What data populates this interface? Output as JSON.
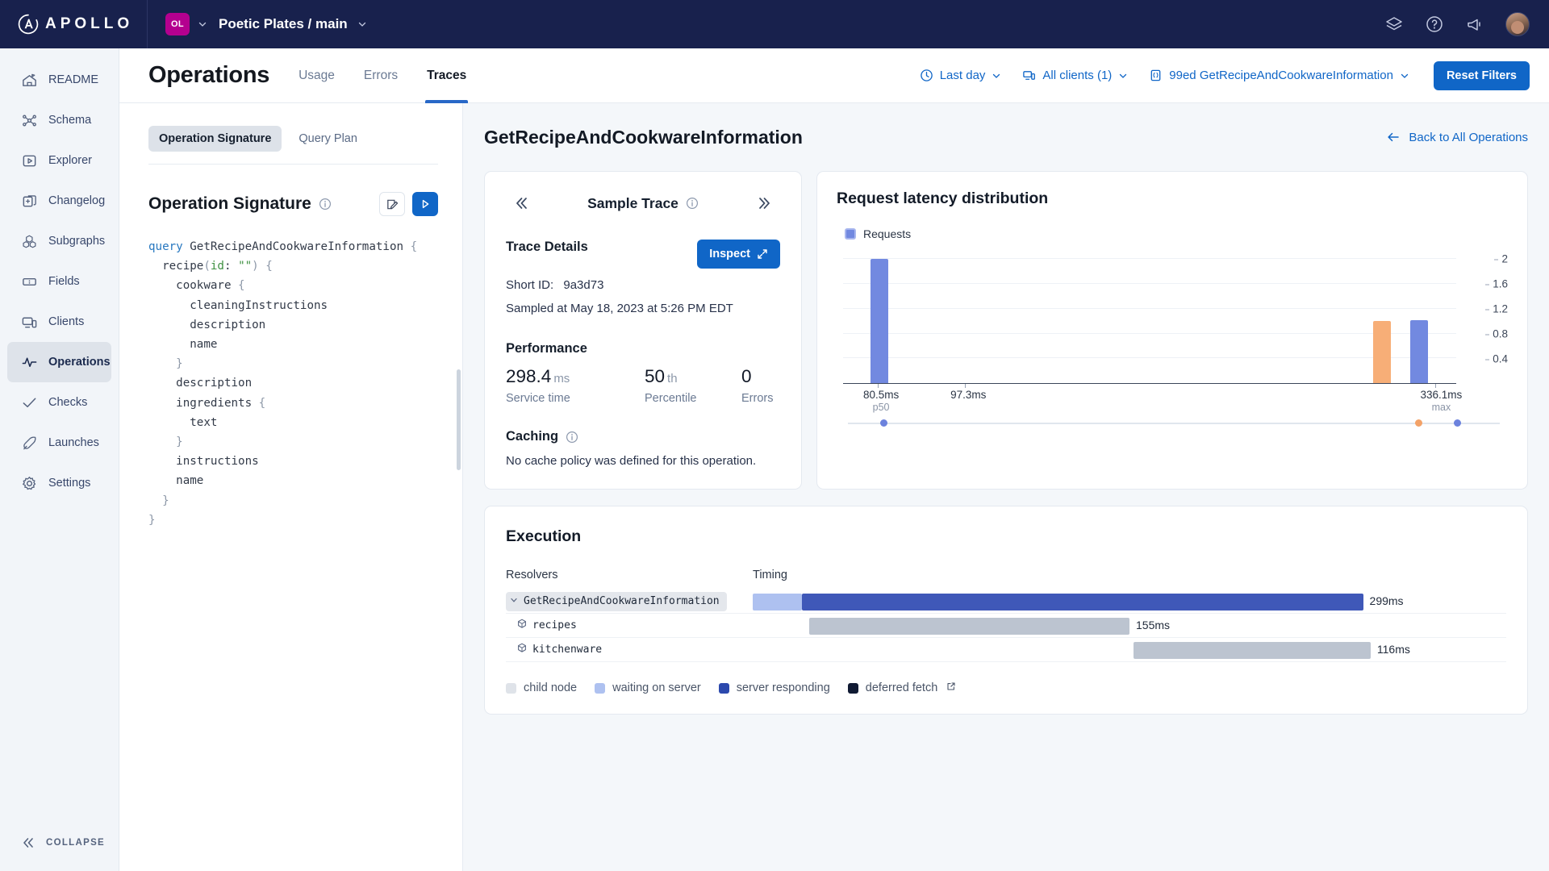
{
  "topbar": {
    "logo_text": "APOLLO",
    "org_badge": "OL",
    "graph_title": "Poetic Plates / main",
    "icons": [
      "graph-icon",
      "help-icon",
      "announcements-icon",
      "user-avatar"
    ]
  },
  "sidebar": {
    "items": [
      {
        "label": "README",
        "icon": "readme-icon",
        "active": false
      },
      {
        "label": "Schema",
        "icon": "schema-icon",
        "active": false
      },
      {
        "label": "Explorer",
        "icon": "explorer-icon",
        "active": false
      },
      {
        "label": "Changelog",
        "icon": "changelog-icon",
        "active": false
      },
      {
        "label": "Subgraphs",
        "icon": "subgraphs-icon",
        "active": false
      },
      {
        "label": "Fields",
        "icon": "fields-icon",
        "active": false
      },
      {
        "label": "Clients",
        "icon": "clients-icon",
        "active": false
      },
      {
        "label": "Operations",
        "icon": "operations-icon",
        "active": true
      },
      {
        "label": "Checks",
        "icon": "checks-icon",
        "active": false
      },
      {
        "label": "Launches",
        "icon": "launches-icon",
        "active": false
      },
      {
        "label": "Settings",
        "icon": "settings-icon",
        "active": false
      }
    ],
    "collapse_label": "COLLAPSE"
  },
  "operations_header": {
    "title": "Operations",
    "tabs": [
      {
        "label": "Usage",
        "active": false
      },
      {
        "label": "Errors",
        "active": false
      },
      {
        "label": "Traces",
        "active": true
      }
    ],
    "filters": [
      {
        "label": "Last day",
        "icon": "clock-icon"
      },
      {
        "label": "All clients (1)",
        "icon": "clients-icon"
      },
      {
        "label": "99ed GetRecipeAndCookwareInformation",
        "icon": "braces-icon"
      }
    ],
    "reset_label": "Reset Filters"
  },
  "signature_panel": {
    "tabs": [
      {
        "label": "Operation Signature",
        "active": true
      },
      {
        "label": "Query Plan",
        "active": false
      }
    ],
    "heading": "Operation Signature",
    "code_lines": [
      {
        "parts": [
          {
            "t": "query ",
            "c": "k-query"
          },
          {
            "t": "GetRecipeAndCookwareInformation ",
            "c": ""
          },
          {
            "t": "{",
            "c": "k-punc"
          }
        ]
      },
      {
        "parts": [
          {
            "t": "  recipe",
            "c": ""
          },
          {
            "t": "(",
            "c": "k-punc"
          },
          {
            "t": "id",
            "c": "k-arg"
          },
          {
            "t": ": ",
            "c": ""
          },
          {
            "t": "\"\"",
            "c": "k-arg"
          },
          {
            "t": ")",
            "c": "k-punc"
          },
          {
            "t": " ",
            "c": ""
          },
          {
            "t": "{",
            "c": "k-punc"
          }
        ]
      },
      {
        "parts": [
          {
            "t": "    cookware ",
            "c": ""
          },
          {
            "t": "{",
            "c": "k-punc"
          }
        ]
      },
      {
        "parts": [
          {
            "t": "      cleaningInstructions",
            "c": ""
          }
        ]
      },
      {
        "parts": [
          {
            "t": "      description",
            "c": ""
          }
        ]
      },
      {
        "parts": [
          {
            "t": "      name",
            "c": ""
          }
        ]
      },
      {
        "parts": [
          {
            "t": "    ",
            "c": ""
          },
          {
            "t": "}",
            "c": "k-punc"
          }
        ]
      },
      {
        "parts": [
          {
            "t": "    description",
            "c": ""
          }
        ]
      },
      {
        "parts": [
          {
            "t": "    ingredients ",
            "c": ""
          },
          {
            "t": "{",
            "c": "k-punc"
          }
        ]
      },
      {
        "parts": [
          {
            "t": "      text",
            "c": ""
          }
        ]
      },
      {
        "parts": [
          {
            "t": "    ",
            "c": ""
          },
          {
            "t": "}",
            "c": "k-punc"
          }
        ]
      },
      {
        "parts": [
          {
            "t": "    instructions",
            "c": ""
          }
        ]
      },
      {
        "parts": [
          {
            "t": "    name",
            "c": ""
          }
        ]
      },
      {
        "parts": [
          {
            "t": "  ",
            "c": ""
          },
          {
            "t": "}",
            "c": "k-punc"
          }
        ]
      },
      {
        "parts": [
          {
            "t": "}",
            "c": "k-punc"
          }
        ]
      }
    ]
  },
  "detail": {
    "operation_name": "GetRecipeAndCookwareInformation",
    "back_label": "Back to All Operations"
  },
  "sample_trace": {
    "title": "Sample Trace",
    "trace_details_title": "Trace Details",
    "short_id_label": "Short ID:",
    "short_id_value": "9a3d73",
    "sampled_at": "Sampled at May 18, 2023 at 5:26 PM EDT",
    "inspect_label": "Inspect",
    "performance_title": "Performance",
    "metrics": [
      {
        "value": "298.4",
        "unit": "ms",
        "label": "Service time"
      },
      {
        "value": "50",
        "unit": "th",
        "label": "Percentile"
      },
      {
        "value": "0",
        "unit": "",
        "label": "Errors"
      }
    ],
    "caching_title": "Caching",
    "caching_text": "No cache policy was defined for this operation."
  },
  "chart_data": {
    "type": "bar",
    "title": "Request latency distribution",
    "legend": [
      "Requests"
    ],
    "legend_position": "top-left",
    "xlabel": "",
    "ylabel": "",
    "ylim": [
      0,
      2.2
    ],
    "yticks": [
      0.4,
      0.8,
      1.2,
      1.6,
      2
    ],
    "grid": true,
    "xtick_labels": [
      {
        "label": "80.5ms",
        "sub": "p50"
      },
      {
        "label": "97.3ms",
        "sub": ""
      },
      {
        "label": "336.1ms",
        "sub": "max"
      }
    ],
    "bars": [
      {
        "x_pos_pct": 4.5,
        "value": 2.0,
        "color": "#7289e0",
        "name": "p50-bucket"
      },
      {
        "x_pos_pct": 86.5,
        "value": 1.0,
        "color": "#f7ae77",
        "name": "bucket-orange"
      },
      {
        "x_pos_pct": 92.5,
        "value": 1.02,
        "color": "#7289e0",
        "name": "bucket-blue"
      }
    ],
    "slider_dots": [
      {
        "pos_pct": 5,
        "color": "#6c82dd"
      },
      {
        "pos_pct": 87,
        "color": "#f3a268"
      },
      {
        "pos_pct": 93,
        "color": "#6c82dd"
      }
    ]
  },
  "execution": {
    "title": "Execution",
    "col_resolvers": "Resolvers",
    "col_timing": "Timing",
    "rows": [
      {
        "name": "GetRecipeAndCookwareInformation",
        "style": "pill",
        "icon": "chevron-down-icon",
        "duration": "299ms",
        "segments": [
          {
            "left_pct": 0,
            "width_pct": 6.5,
            "color": "#aec1f0"
          },
          {
            "left_pct": 6.5,
            "width_pct": 74.5,
            "color": "#3f58b8"
          }
        ]
      },
      {
        "name": "recipes",
        "style": "plain",
        "icon": "cube-icon",
        "duration": "155ms",
        "segments": [
          {
            "left_pct": 7.5,
            "width_pct": 42.5,
            "color": "#bcc4d0"
          }
        ]
      },
      {
        "name": "kitchenware",
        "style": "plain",
        "icon": "cube-icon",
        "duration": "116ms",
        "segments": [
          {
            "left_pct": 50.5,
            "width_pct": 31.5,
            "color": "#bcc4d0"
          }
        ]
      }
    ],
    "legend": [
      {
        "label": "child node",
        "color": "#dfe3e9"
      },
      {
        "label": "waiting on server",
        "color": "#aec1f0"
      },
      {
        "label": "server responding",
        "color": "#2c49ad"
      },
      {
        "label": "deferred fetch",
        "color": "#101a33",
        "external": true
      }
    ]
  }
}
